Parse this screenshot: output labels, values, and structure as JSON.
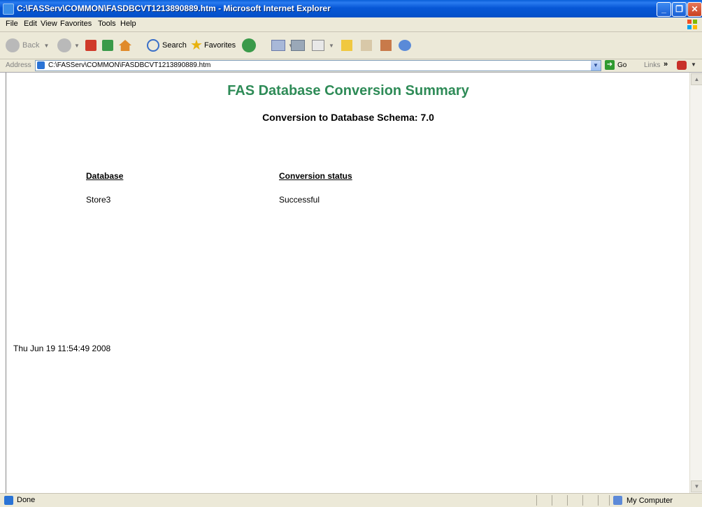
{
  "window": {
    "title": "C:\\FASServ\\COMMON\\FASDBCVT1213890889.htm - Microsoft Internet Explorer"
  },
  "menu": [
    "File",
    "Edit",
    "View",
    "Favorites",
    "Tools",
    "Help"
  ],
  "toolbar": {
    "back_label": "Back",
    "search_label": "Search",
    "favorites_label": "Favorites"
  },
  "address": {
    "label": "Address",
    "value": "C:\\FASServ\\COMMON\\FASDBCVT1213890889.htm",
    "go_label": "Go",
    "links_label": "Links"
  },
  "page": {
    "title": "FAS Database Conversion Summary",
    "subtitle": "Conversion to Database Schema: 7.0",
    "columns": [
      "Database",
      "Conversion status"
    ],
    "rows": [
      [
        "Store3",
        "Successful"
      ]
    ],
    "timestamp": "Thu Jun 19 11:54:49 2008"
  },
  "status": {
    "text": "Done",
    "zone": "My Computer"
  },
  "colors": {
    "heading": "#2e8b57",
    "titlebar": "#0a5fd8"
  }
}
